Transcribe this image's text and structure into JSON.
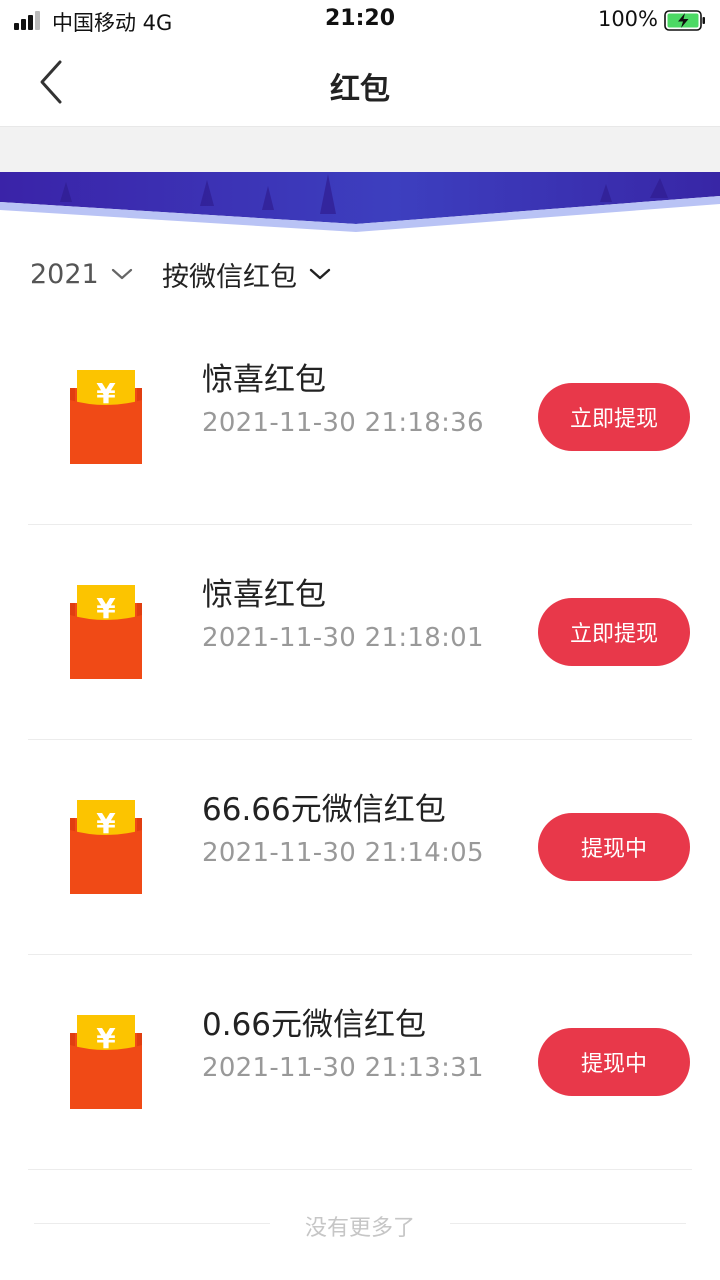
{
  "status_bar": {
    "carrier": "中国移动   4G",
    "time": "21:20",
    "battery_percent": "100%",
    "battery_icon": "battery-charging-icon",
    "signal_icon": "signal-bars-icon"
  },
  "nav": {
    "title": "红包",
    "back_icon": "back-chevron-icon"
  },
  "filters": {
    "year": "2021",
    "type": "按微信红包",
    "chevron_icon": "chevron-down-icon"
  },
  "items": [
    {
      "name": "惊喜红包",
      "time": "2021-11-30 21:18:36",
      "action": "立即提现"
    },
    {
      "name": "惊喜红包",
      "time": "2021-11-30 21:18:01",
      "action": "立即提现"
    },
    {
      "name": "66.66元微信红包",
      "time": "2021-11-30 21:14:05",
      "action": "提现中"
    },
    {
      "name": "0.66元微信红包",
      "time": "2021-11-30 21:13:31",
      "action": "提现中"
    }
  ],
  "packet_symbol": "¥",
  "footer": {
    "text": "没有更多了"
  },
  "colors": {
    "accent": "#e8384a",
    "packet_body": "#f04a16",
    "packet_flap": "#fcc400",
    "banner": "#3c2bb0",
    "banner_edge": "#b9c3f5",
    "battery_fill": "#4cd964"
  }
}
